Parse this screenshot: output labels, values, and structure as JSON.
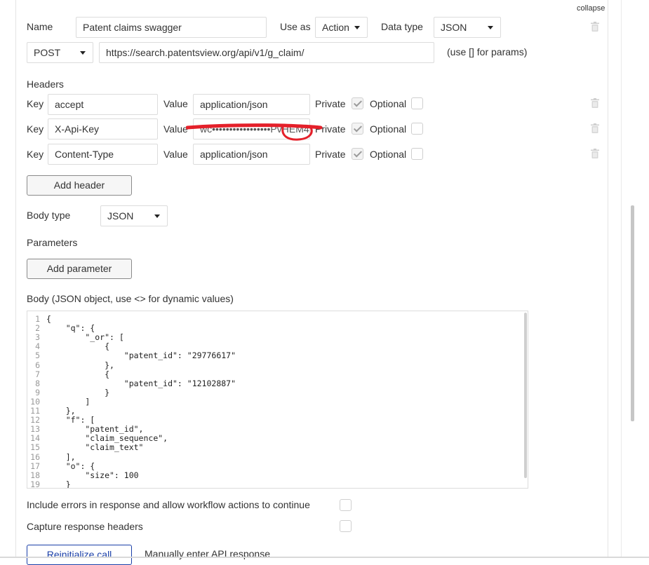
{
  "header": {
    "collapse_label": "collapse"
  },
  "call": {
    "name_label": "Name",
    "name_value": "Patent claims swagger",
    "use_as_label": "Use as",
    "use_as_value": "Action",
    "data_type_label": "Data type",
    "data_type_value": "JSON",
    "method_value": "POST",
    "url_value": "https://search.patentsview.org/api/v1/g_claim/",
    "url_hint": "(use [] for params)"
  },
  "headers": {
    "title": "Headers",
    "key_label": "Key",
    "value_label": "Value",
    "private_label": "Private",
    "optional_label": "Optional",
    "rows": [
      {
        "key": "accept",
        "value": "application/json",
        "private": true,
        "optional": false
      },
      {
        "key": "X-Api-Key",
        "value": "wc•••••••••••••••••PvHEM4C",
        "private": true,
        "optional": false
      },
      {
        "key": "Content-Type",
        "value": "application/json",
        "private": true,
        "optional": false
      }
    ],
    "add_header_label": "Add header"
  },
  "body_type": {
    "label": "Body type",
    "value": "JSON"
  },
  "parameters": {
    "title": "Parameters",
    "add_parameter_label": "Add parameter"
  },
  "body": {
    "label": "Body (JSON object, use <> for dynamic values)",
    "line_numbers": [
      "1",
      "2",
      "3",
      "4",
      "5",
      "6",
      "7",
      "8",
      "9",
      "10",
      "11",
      "12",
      "13",
      "14",
      "15",
      "16",
      "17",
      "18",
      "19"
    ],
    "lines": [
      "{",
      "    \"q\": {",
      "        \"_or\": [",
      "            {",
      "                \"patent_id\": \"29776617\"",
      "            },",
      "            {",
      "                \"patent_id\": \"12102887\"",
      "            }",
      "        ]",
      "    },",
      "    \"f\": [",
      "        \"patent_id\",",
      "        \"claim_sequence\",",
      "        \"claim_text\"",
      "    ],",
      "    \"o\": {",
      "        \"size\": 100",
      "    }"
    ]
  },
  "options": {
    "include_errors_label": "Include errors in response and allow workflow actions to continue",
    "capture_headers_label": "Capture response headers"
  },
  "footer": {
    "reinitialize_label": "Reinitialize call",
    "manual_label": "Manually enter API response"
  },
  "colors": {
    "annotation_red": "#e4202a",
    "border": "#dcdcdc",
    "link_blue": "#1a3fa8"
  },
  "icons": [
    "trash-icon",
    "chevron-down-icon",
    "checkmark-icon"
  ]
}
